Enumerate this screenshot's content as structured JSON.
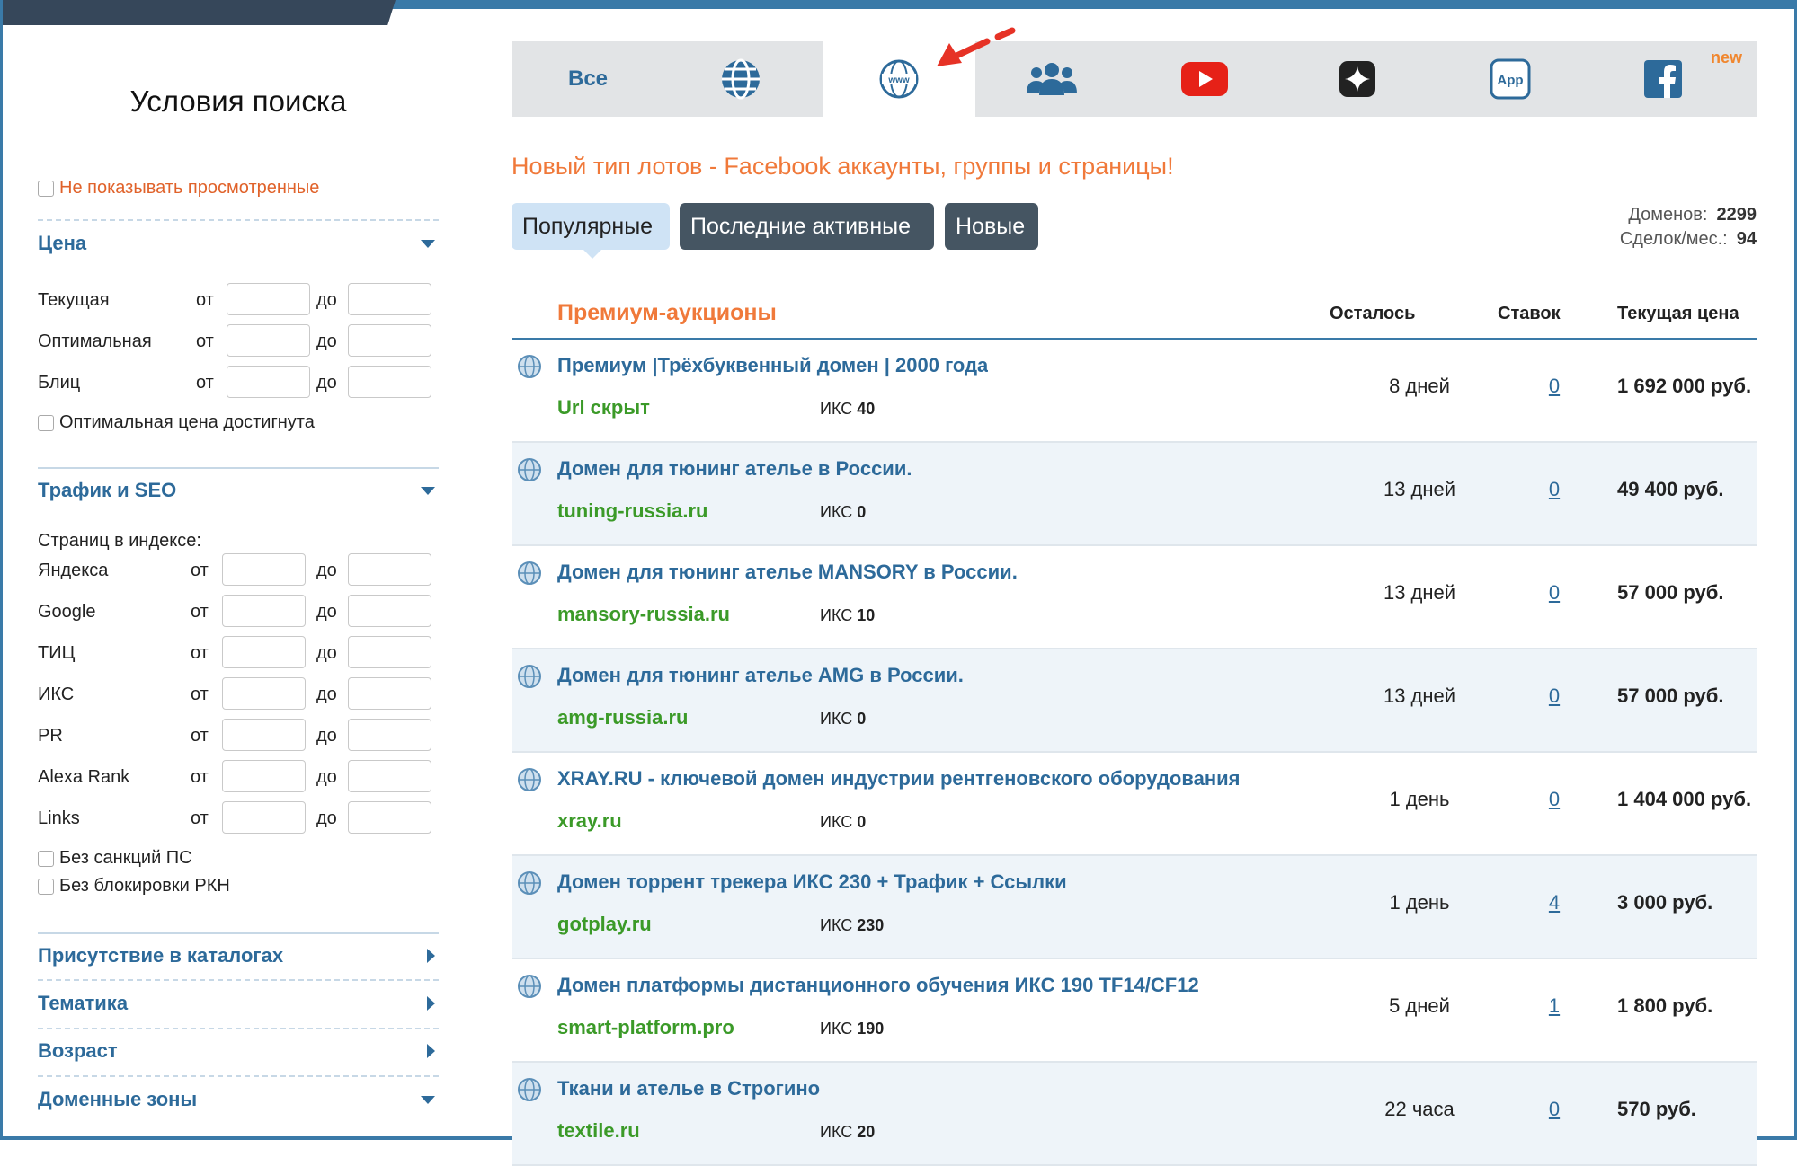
{
  "sidebar": {
    "title": "Условия поиска",
    "hide_viewed": "Не показывать просмотренные",
    "price": {
      "heading": "Цена",
      "rows": [
        {
          "label": "Текущая",
          "from": "от",
          "to": "до"
        },
        {
          "label": "Оптимальная",
          "from": "от",
          "to": "до"
        },
        {
          "label": "Блиц",
          "from": "от",
          "to": "до"
        }
      ],
      "optimal_reached": "Оптимальная цена достигнута"
    },
    "traffic": {
      "heading": "Трафик и SEO",
      "pages_in_index": "Страниц в индексе:",
      "rows": [
        {
          "label": "Яндекса",
          "from": "от",
          "to": "до"
        },
        {
          "label": "Google",
          "from": "от",
          "to": "до"
        },
        {
          "label": "ТИЦ",
          "from": "от",
          "to": "до"
        },
        {
          "label": "ИКС",
          "from": "от",
          "to": "до"
        },
        {
          "label": "PR",
          "from": "от",
          "to": "до"
        },
        {
          "label": "Alexa Rank",
          "from": "от",
          "to": "до"
        },
        {
          "label": "Links",
          "from": "от",
          "to": "до"
        }
      ],
      "no_sanctions": "Без санкций ПС",
      "no_rkn_block": "Без блокировки РКН"
    },
    "sections": [
      "Присутствие в каталогах",
      "Тематика",
      "Возраст",
      "Доменные зоны"
    ]
  },
  "tabs": {
    "all": "Все",
    "app": "App",
    "new_badge": "new"
  },
  "headline": "Новый тип лотов - Facebook аккаунты, группы и страницы!",
  "filters": [
    "Популярные",
    "Последние активные",
    "Новые"
  ],
  "stats": {
    "domains_label": "Доменов:",
    "domains_value": "2299",
    "deals_label": "Сделок/мес.:",
    "deals_value": "94"
  },
  "table": {
    "title": "Премиум-аукционы",
    "col_left": "Осталось",
    "col_bids": "Ставок",
    "col_price": "Текущая цена",
    "rows": [
      {
        "title": "Премиум |Трёхбуквенный домен | 2000 года",
        "url": "Url скрыт",
        "iks_label": "ИКС",
        "iks": "40",
        "left": "8 дней",
        "bids": "0",
        "price": "1 692 000 руб."
      },
      {
        "title": "Домен для тюнинг ателье в России.",
        "url": "tuning-russia.ru",
        "iks_label": "ИКС",
        "iks": "0",
        "left": "13 дней",
        "bids": "0",
        "price": "49 400 руб."
      },
      {
        "title": "Домен для тюнинг ателье MANSORY в России.",
        "url": "mansory-russia.ru",
        "iks_label": "ИКС",
        "iks": "10",
        "left": "13 дней",
        "bids": "0",
        "price": "57 000 руб."
      },
      {
        "title": "Домен для тюнинг ателье AMG в России.",
        "url": "amg-russia.ru",
        "iks_label": "ИКС",
        "iks": "0",
        "left": "13 дней",
        "bids": "0",
        "price": "57 000 руб."
      },
      {
        "title": "XRAY.RU - ключевой домен индустрии рентгеновского оборудования",
        "url": "xray.ru",
        "iks_label": "ИКС",
        "iks": "0",
        "left": "1 день",
        "bids": "0",
        "price": "1 404 000 руб."
      },
      {
        "title": "Домен торрент трекера ИКС 230 + Трафик + Ссылки",
        "url": "gotplay.ru",
        "iks_label": "ИКС",
        "iks": "230",
        "left": "1 день",
        "bids": "4",
        "price": "3 000 руб."
      },
      {
        "title": "Домен платформы дистанционного обучения ИКС 190 TF14/CF12",
        "url": "smart-platform.pro",
        "iks_label": "ИКС",
        "iks": "190",
        "left": "5 дней",
        "bids": "1",
        "price": "1 800 руб."
      },
      {
        "title": "Ткани и ателье в Строгино",
        "url": "textile.ru",
        "iks_label": "ИКС",
        "iks": "20",
        "left": "22 часа",
        "bids": "0",
        "price": "570 руб."
      }
    ]
  },
  "colors": {
    "accent_blue": "#2d6a9a",
    "accent_orange": "#f0793a",
    "url_green": "#3b9a28",
    "youtube_red": "#e62117",
    "facebook_blue": "#2d6a9a"
  },
  "icons": [
    "globe-icon",
    "www-globe-icon",
    "users-icon",
    "youtube-icon",
    "sparkle-icon",
    "app-icon",
    "facebook-icon",
    "red-arrow-icon"
  ]
}
